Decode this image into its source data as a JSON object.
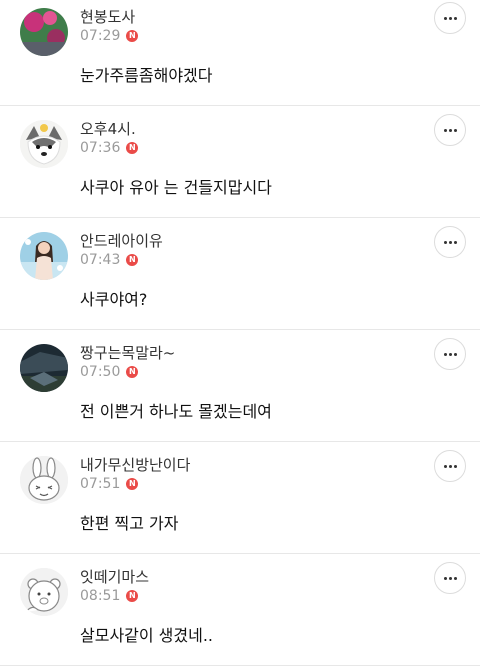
{
  "comments": [
    {
      "nickname": "현봉도사",
      "time": "07:29",
      "badge": "N",
      "text": "눈가주름좀해야겠다",
      "avatar": "flower-photo"
    },
    {
      "nickname": "오후4시.",
      "time": "07:36",
      "badge": "N",
      "text": "사쿠아 유아 는 건들지맙시다",
      "avatar": "husky-photo"
    },
    {
      "nickname": "안드레아이유",
      "time": "07:43",
      "badge": "N",
      "text": "사쿠야여?",
      "avatar": "person-photo"
    },
    {
      "nickname": "짱구는목말라~",
      "time": "07:50",
      "badge": "N",
      "text": "전 이쁜거 하나도 몰겠는데여",
      "avatar": "dark-photo"
    },
    {
      "nickname": "내가무신방난이다",
      "time": "07:51",
      "badge": "N",
      "text": "한편 찍고 가자",
      "avatar": "rabbit-character"
    },
    {
      "nickname": "잇떼기마스",
      "time": "08:51",
      "badge": "N",
      "text": "살모사같이 생겼네..",
      "avatar": "bear-character"
    }
  ],
  "colors": {
    "badge": "#ea4b48",
    "divider": "#e7e7e7",
    "meta": "#9a9a9a"
  },
  "icons": {
    "more": "more-dots-icon"
  }
}
